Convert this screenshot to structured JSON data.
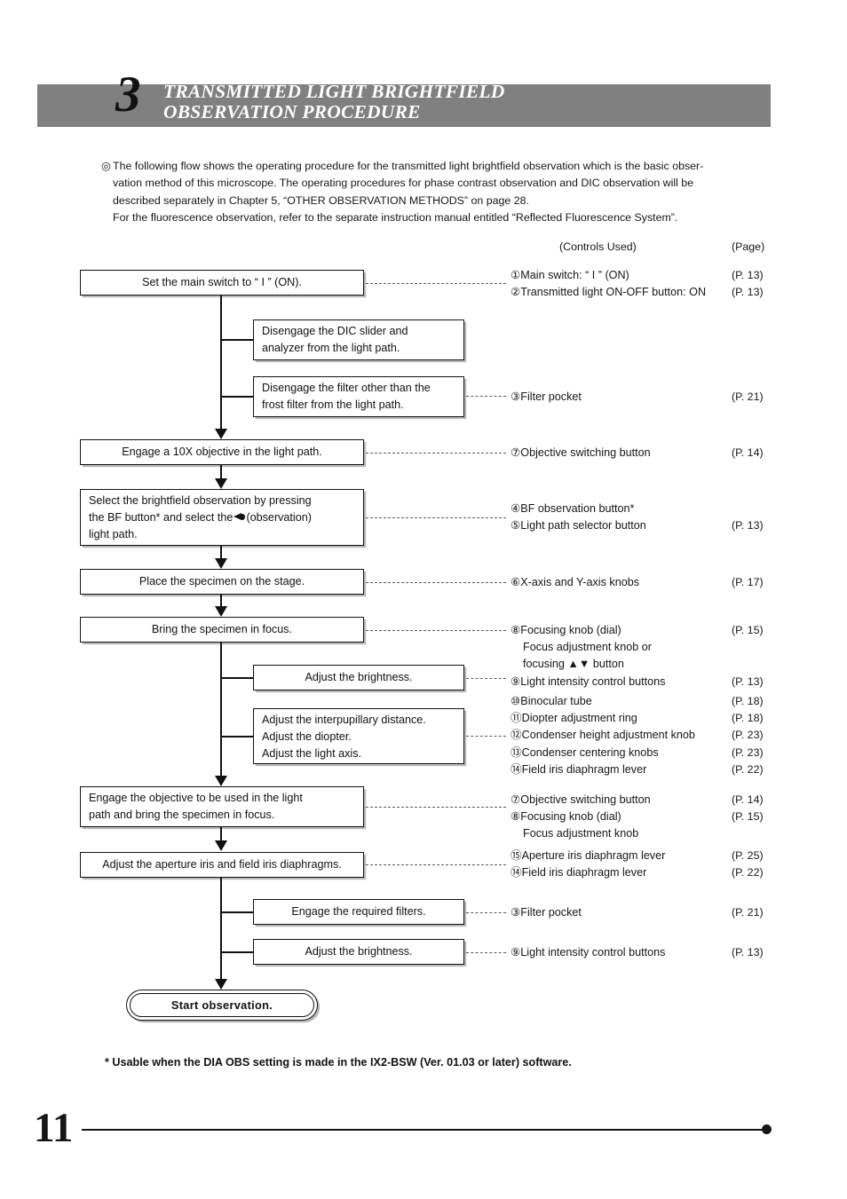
{
  "header": {
    "number": "3",
    "title_line1": "TRANSMITTED LIGHT BRIGHTFIELD",
    "title_line2": "OBSERVATION PROCEDURE",
    "band_color": "#808080"
  },
  "intro": {
    "bullet": "◎",
    "line1": "The following flow shows the operating procedure for the transmitted light brightfield observation which is the basic obser-",
    "line2": "vation method of this microscope. The operating procedures for phase contrast observation and DIC observation will be",
    "line3": "described separately in Chapter 5, “OTHER OBSERVATION METHODS” on page 28.",
    "line4": "For the fluorescence observation, refer to the separate instruction manual entitled “Reflected Fluorescence System”."
  },
  "columns": {
    "controls_header": "(Controls Used)",
    "page_header": "(Page)"
  },
  "flow": {
    "main_switch": "Set the main switch to “ I ” (ON).",
    "dic_slider_l1": "Disengage  the  DIC  slider  and",
    "dic_slider_l2": "analyzer from the light path.",
    "filter_l1": "Disengage the filter other than the",
    "filter_l2": "frost filter from the light path.",
    "objective_10x": "Engage a 10X objective in the light path.",
    "brightfield_l1": "Select  the  brightfield  observation  by  pressing",
    "brightfield_l2a": "the BF button* and select the",
    "brightfield_l2b": "(observation)",
    "brightfield_l3": "light path.",
    "place_specimen": "Place the specimen on the stage.",
    "bring_focus": "Bring the specimen in focus.",
    "adjust_brightness_1": "Adjust the brightness.",
    "interpupillary_l1": "Adjust the interpupillary distance.",
    "interpupillary_l2": "Adjust the diopter.",
    "interpupillary_l3": "Adjust the light axis.",
    "engage_objective_l1": "Engage  the  objective  to  be  used  in  the  light",
    "engage_objective_l2": "path and bring the specimen in focus.",
    "adjust_iris": "Adjust the aperture iris and field iris diaphragms.",
    "engage_filters": "Engage the required filters.",
    "adjust_brightness_2": "Adjust the brightness.",
    "start_observation": "Start  observation."
  },
  "controls": {
    "g1_l1": "①Main switch: “ I ” (ON)",
    "g1_l2": "②Transmitted light ON-OFF button: ON",
    "g1_p1": "(P. 13)",
    "g1_p2": "(P. 13)",
    "g2_l1": "③Filter pocket",
    "g2_p1": "(P. 21)",
    "g3_l1": "⑦Objective switching button",
    "g3_p1": "(P. 14)",
    "g4_l1": "④BF observation button*",
    "g4_l2": "⑤Light path selector button",
    "g4_p2": "(P. 13)",
    "g5_l1": "⑥X-axis and Y-axis knobs",
    "g5_p1": "(P. 17)",
    "g6_l1": "⑧Focusing knob (dial)",
    "g6_l2": "Focus adjustment knob or",
    "g6_l3": "focusing ▲▼ button",
    "g6_l4": "⑨Light intensity control buttons",
    "g6_p1": "(P. 15)",
    "g6_p4": "(P. 13)",
    "g7_l1": "⑩Binocular tube",
    "g7_l2": "⑪Diopter adjustment ring",
    "g7_l3": "⑫Condenser height adjustment knob",
    "g7_l4": "⑬Condenser centering knobs",
    "g7_l5": "⑭Field iris diaphragm lever",
    "g7_p1": "(P. 18)",
    "g7_p2": "(P. 18)",
    "g7_p3": "(P. 23)",
    "g7_p4": "(P. 23)",
    "g7_p5": "(P. 22)",
    "g8_l1": "⑦Objective switching button",
    "g8_l2": "⑧Focusing knob (dial)",
    "g8_l3": "Focus adjustment knob",
    "g8_p1": "(P. 14)",
    "g8_p2": "(P. 15)",
    "g9_l1": "⑮Aperture iris diaphragm lever",
    "g9_l2": "⑭Field iris diaphragm lever",
    "g9_p1": "(P. 25)",
    "g9_p2": "(P. 22)",
    "g10_l1": "③Filter pocket",
    "g10_p1": "(P. 21)",
    "g11_l1": "⑨Light intensity control buttons",
    "g11_p1": "(P. 13)"
  },
  "footnote": "* Usable when the DIA OBS setting is made in the IX2-BSW (Ver. 01.03 or later) software.",
  "footer": {
    "page_number": "11"
  }
}
